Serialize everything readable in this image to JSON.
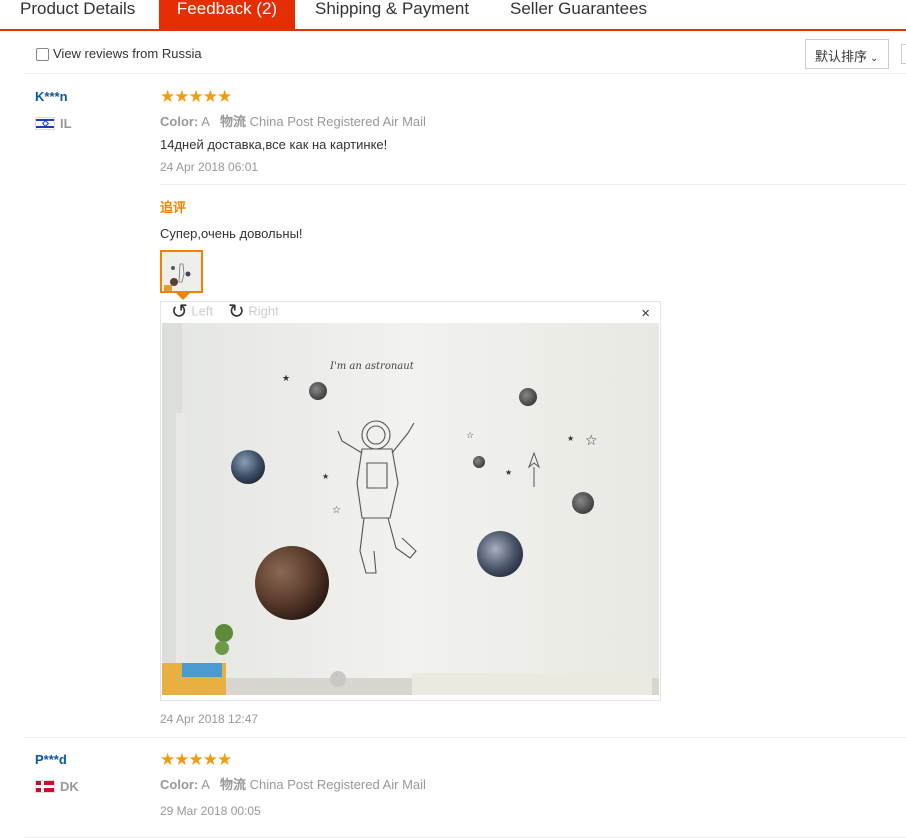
{
  "tabs": [
    {
      "label": "Product Details"
    },
    {
      "label": "Feedback (2)"
    },
    {
      "label": "Shipping & Payment"
    },
    {
      "label": "Seller Guarantees"
    }
  ],
  "filter": {
    "checkbox_label": "View reviews from Russia",
    "sort_label": "默认排序",
    "sort_chevron": "⌄"
  },
  "stars": "★★★★★",
  "rating": 5,
  "reviews": [
    {
      "user": "K***n",
      "country": "IL",
      "color_label": "Color:",
      "color_value": "A",
      "shipping_label": "物流",
      "shipping_value": "China Post Registered Air Mail",
      "text": "14дней доставка,все как на картинке!",
      "date": "24 Apr 2018 06:01",
      "additional": {
        "label": "追评",
        "text": "Супер,очень довольны!",
        "date": "24 Apr 2018 12:47",
        "viewer": {
          "left_label": "Left",
          "right_label": "Right",
          "close": "×",
          "wall_text": "I'm an astronaut"
        }
      }
    },
    {
      "user": "P***d",
      "country": "DK",
      "color_label": "Color:",
      "color_value": "A",
      "shipping_label": "物流",
      "shipping_value": "China Post Registered Air Mail",
      "date": "29 Mar 2018 00:05"
    }
  ],
  "colors": {
    "accent": "#e62e04",
    "username": "#0a57a5",
    "star": "#f39c12",
    "additional": "#f08200"
  }
}
